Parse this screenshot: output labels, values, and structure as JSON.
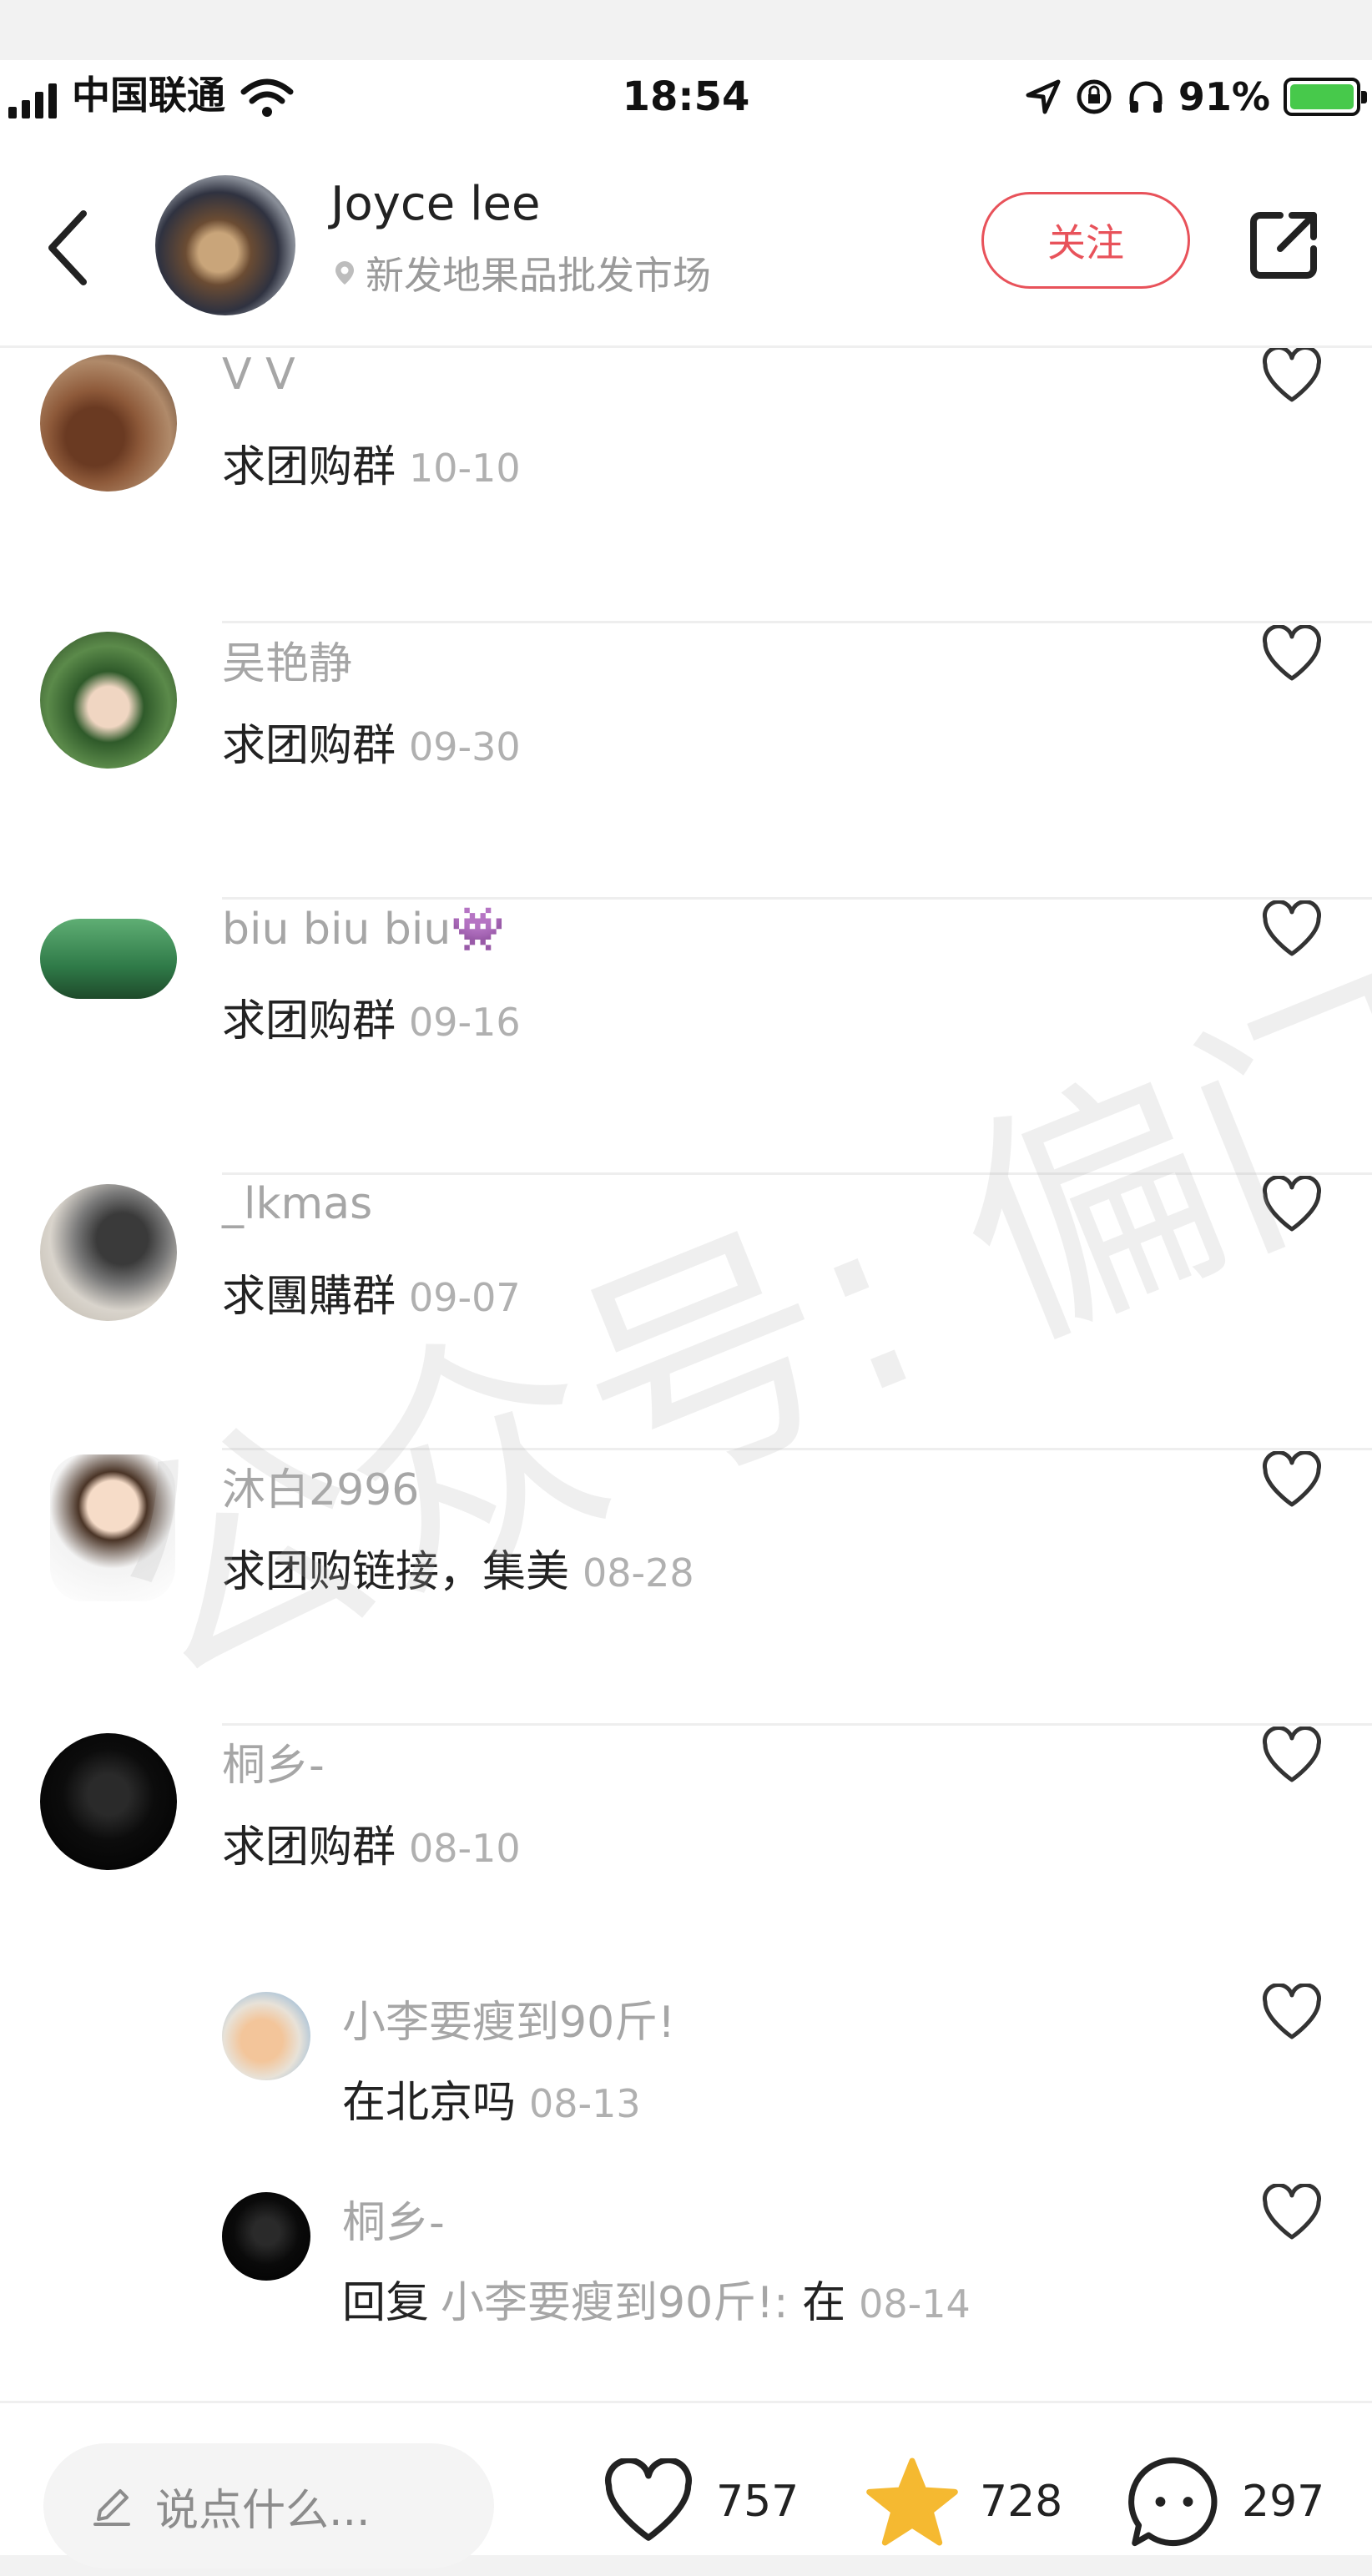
{
  "status_bar": {
    "carrier": "中国联通",
    "time": "18:54",
    "battery": "91%",
    "battery_level": 0.91
  },
  "header": {
    "author_name": "Joyce lee",
    "location": "新发地果品批发市场",
    "follow_label": "关注"
  },
  "comments": [
    {
      "user": "V V",
      "text": "求团购群",
      "date": "10-10"
    },
    {
      "user": "吴艳静",
      "text": "求团购群",
      "date": "09-30"
    },
    {
      "user": "biu biu biu👾",
      "text": "求团购群",
      "date": "09-16"
    },
    {
      "user": "_lkmas",
      "text": "求團購群",
      "date": "09-07"
    },
    {
      "user": "沐白2996",
      "text": "求团购链接，集美",
      "date": "08-28"
    },
    {
      "user": "桐乡-",
      "text": "求团购群",
      "date": "08-10"
    }
  ],
  "replies": [
    {
      "user": "小李要瘦到90斤!",
      "text": "在北京吗",
      "date": "08-13"
    },
    {
      "user": "桐乡-",
      "reply_prefix": "回复",
      "reply_to": "小李要瘦到90斤!:",
      "text": "在",
      "date": "08-14"
    }
  ],
  "bottom_bar": {
    "input_placeholder": "说点什么...",
    "like_count": "757",
    "collect_count": "728",
    "comment_count": "297"
  },
  "watermark": "公众号: 偏门圈",
  "colors": {
    "accent": "#e8525a",
    "star": "#f5b931",
    "secondary_text": "#a6a6a6"
  },
  "icons": [
    "back-icon",
    "location-pin-icon",
    "share-icon",
    "heart-icon",
    "pencil-icon",
    "star-icon",
    "comment-bubble-icon"
  ]
}
